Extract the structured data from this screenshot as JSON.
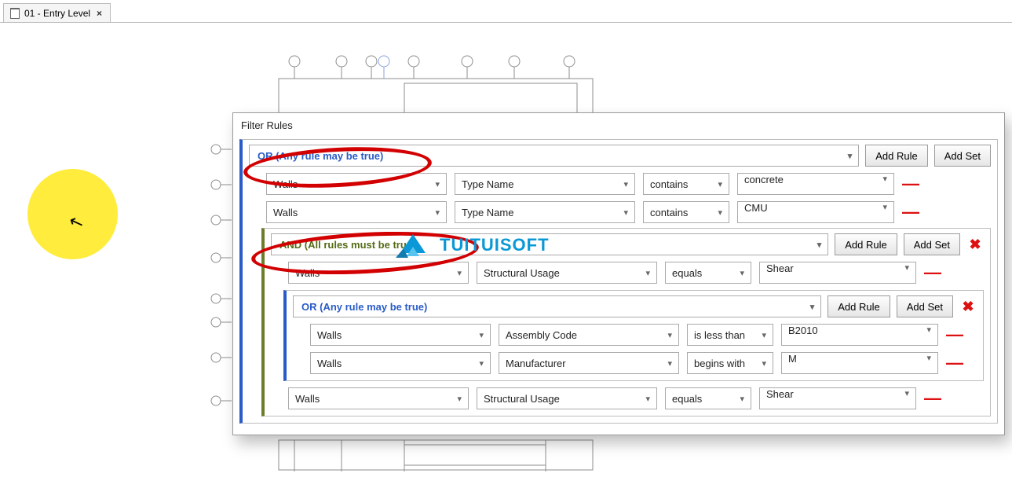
{
  "tab": {
    "title": "01 - Entry Level"
  },
  "dialog": {
    "title": "Filter Rules"
  },
  "buttons": {
    "add_rule": "Add Rule",
    "add_set": "Add Set"
  },
  "or_outer": {
    "label": "OR (Any rule may be true)",
    "rules": [
      {
        "cat": "Walls",
        "param": "Type Name",
        "op": "contains",
        "val": "concrete"
      },
      {
        "cat": "Walls",
        "param": "Type Name",
        "op": "contains",
        "val": "CMU"
      }
    ]
  },
  "and_inner": {
    "label": "AND (All rules must be true)",
    "rules_before": [
      {
        "cat": "Walls",
        "param": "Structural Usage",
        "op": "equals",
        "val": "Shear"
      }
    ],
    "or_nested": {
      "label": "OR (Any rule may be true)",
      "rules": [
        {
          "cat": "Walls",
          "param": "Assembly Code",
          "op": "is less than",
          "val": "B2010"
        },
        {
          "cat": "Walls",
          "param": "Manufacturer",
          "op": "begins with",
          "val": "M"
        }
      ]
    },
    "rules_after": [
      {
        "cat": "Walls",
        "param": "Structural Usage",
        "op": "equals",
        "val": "Shear"
      }
    ]
  },
  "watermark_text": "TUITUISOFT"
}
